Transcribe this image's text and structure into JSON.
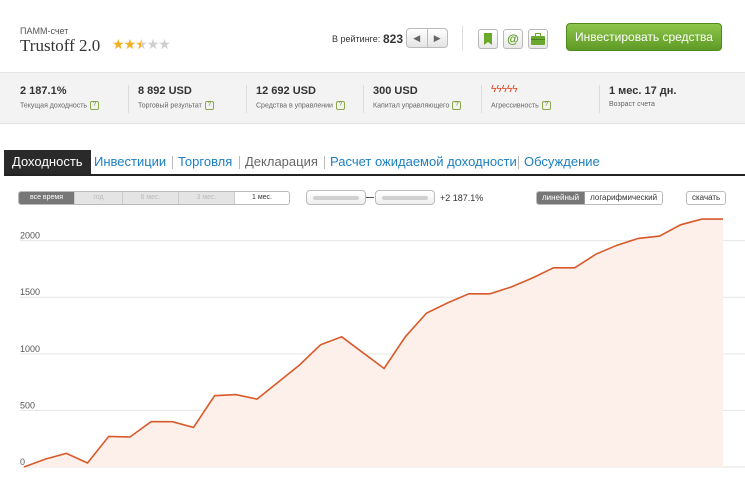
{
  "header": {
    "account_type": "ПАММ-счет",
    "account_name": "Trustoff 2.0",
    "rating_stars": 2.5,
    "rating_label": "В рейтинге:",
    "rating_value": "823",
    "prev_icon": "arrow-left-icon",
    "next_icon": "arrow-right-icon",
    "bookmark_icon": "bookmark-icon",
    "email_icon": "at-icon",
    "portfolio_icon": "briefcase-icon",
    "invest_label": "Инвестировать средства",
    "invest_color": "#6aa82e"
  },
  "stats": [
    {
      "value": "2 187.1%",
      "label": "Текущая доходность",
      "help": "?"
    },
    {
      "value": "8 892 USD",
      "label": "Торговый результат",
      "help": "?"
    },
    {
      "value": "12 692 USD",
      "label": "Средства в управлении",
      "help": "?"
    },
    {
      "value": "300 USD",
      "label": "Капитал управляющего",
      "help": "?"
    },
    {
      "value": "ϟϟϟϟϟ",
      "label": "Агрессивность",
      "help": "?"
    },
    {
      "value": "1 мес. 17 дн.",
      "label": "Возраст счета",
      "help": ""
    }
  ],
  "tabs": [
    {
      "label": "Доходность",
      "state": "active"
    },
    {
      "label": "Инвестиции",
      "state": "link"
    },
    {
      "label": "Торговля",
      "state": "link"
    },
    {
      "label": "Декларация",
      "state": "disabled"
    },
    {
      "label": "Расчет ожидаемой доходности",
      "state": "link"
    },
    {
      "label": "Обсуждение",
      "state": "link"
    }
  ],
  "controls": {
    "ranges": [
      "все время",
      "год",
      "6 мес.",
      "3 мес.",
      "1 мес."
    ],
    "selected_range": "все время",
    "delta": "+2 187.1%",
    "scales": [
      "линейный",
      "логарифмический"
    ],
    "selected_scale": "линейный",
    "download_label": "скачать"
  },
  "chart_data": {
    "type": "area",
    "y_ticks": [
      0,
      500,
      1000,
      1500,
      2000
    ],
    "y_tick_labels": [
      "0",
      "500",
      "1000",
      "1500",
      "2000"
    ],
    "ylim": [
      0,
      2200
    ],
    "line_color": "#d85a2a",
    "fill_color": "#fdf0eb",
    "grid": true,
    "values": [
      0,
      70,
      120,
      35,
      270,
      265,
      400,
      400,
      350,
      630,
      640,
      600,
      750,
      900,
      1080,
      1150,
      1010,
      870,
      1150,
      1360,
      1450,
      1530,
      1530,
      1590,
      1670,
      1760,
      1760,
      1880,
      1960,
      2020,
      2040,
      2140,
      2190,
      2190
    ]
  }
}
